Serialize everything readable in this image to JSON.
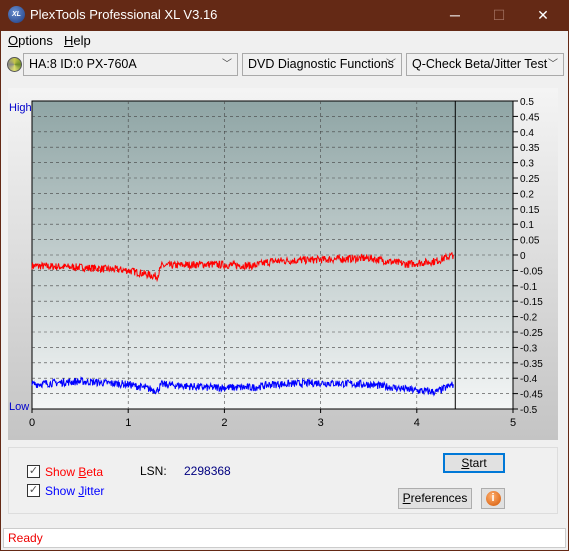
{
  "window": {
    "title": "PlexTools Professional XL V3.16",
    "logo_text": "XL",
    "minimize": "─",
    "maximize": "☐",
    "close": "✕"
  },
  "menu": [
    {
      "label": "Options",
      "ul": "O",
      "rest": "ptions"
    },
    {
      "label": "Help",
      "ul": "H",
      "rest": "elp"
    }
  ],
  "toolbar": {
    "drive": "HA:8 ID:0  PX-760A",
    "function": "DVD Diagnostic Functions",
    "test": "Q-Check Beta/Jitter Test",
    "drive_icon": "disc-icon"
  },
  "chart_data": {
    "type": "line",
    "x_range": [
      0,
      5
    ],
    "y_range": [
      -0.5,
      0.5
    ],
    "x_ticks": [
      "0",
      "1",
      "2",
      "3",
      "4",
      "5"
    ],
    "y_ticks": [
      "0.5",
      "0.45",
      "0.4",
      "0.35",
      "0.3",
      "0.25",
      "0.2",
      "0.15",
      "0.1",
      "0.05",
      "0",
      "-0.05",
      "-0.1",
      "-0.15",
      "-0.2",
      "-0.25",
      "-0.3",
      "-0.35",
      "-0.4",
      "-0.45",
      "-0.5"
    ],
    "left_labels": {
      "high": "High",
      "low": "Low"
    },
    "grid": true,
    "cursor_x": 4.4,
    "series": [
      {
        "name": "Beta",
        "color": "#ff0000",
        "x": [
          0,
          0.5,
          1.0,
          1.3,
          1.35,
          1.8,
          2.3,
          2.5,
          3.0,
          3.5,
          3.9,
          4.2,
          4.38
        ],
        "y": [
          -0.035,
          -0.04,
          -0.05,
          -0.07,
          -0.035,
          -0.03,
          -0.035,
          -0.02,
          -0.015,
          -0.01,
          -0.03,
          -0.02,
          0.0
        ]
      },
      {
        "name": "Jitter",
        "color": "#0000ff",
        "x": [
          0,
          0.5,
          1.0,
          1.3,
          1.35,
          1.8,
          2.3,
          2.5,
          3.0,
          3.5,
          4.0,
          4.2,
          4.38
        ],
        "y": [
          -0.42,
          -0.41,
          -0.42,
          -0.44,
          -0.42,
          -0.43,
          -0.43,
          -0.42,
          -0.415,
          -0.42,
          -0.44,
          -0.445,
          -0.42
        ]
      }
    ]
  },
  "controls": {
    "show_beta": "Show Beta",
    "show_beta_ul": "B",
    "show_jitter": "Show Jitter",
    "show_jitter_ul": "J",
    "lsn_label": "LSN:",
    "lsn_value": "2298368",
    "start": "Start",
    "preferences": "Preferences",
    "info_icon": "info-icon"
  },
  "status": "Ready"
}
